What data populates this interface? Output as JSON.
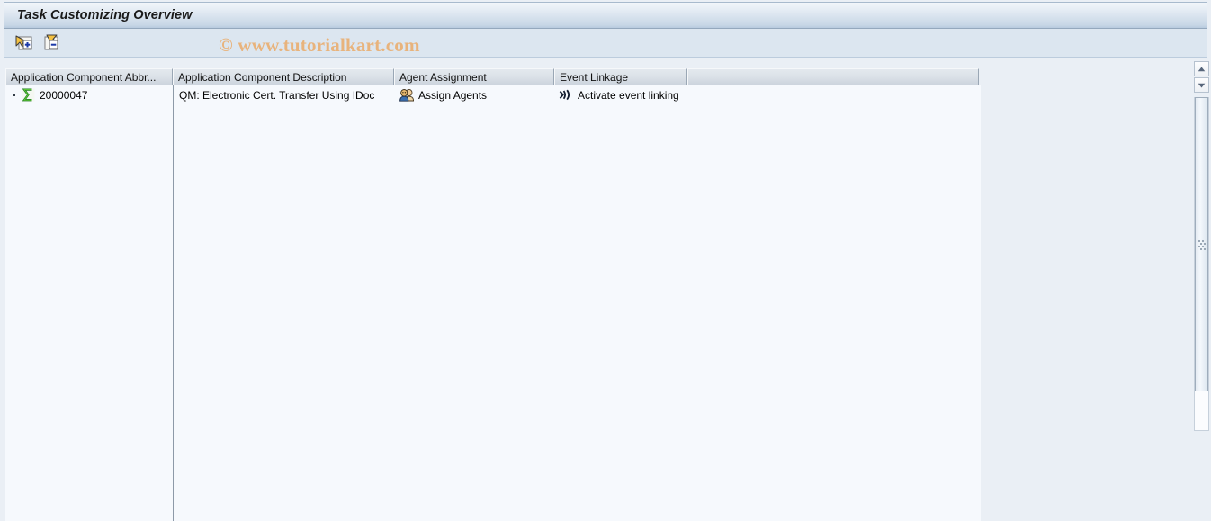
{
  "window": {
    "title": "Task Customizing Overview"
  },
  "toolbar": {
    "buttons": [
      {
        "name": "expand-all-button",
        "icon": "expand-all-icon",
        "tooltip": "Expand all"
      },
      {
        "name": "collapse-all-button",
        "icon": "collapse-all-icon",
        "tooltip": "Collapse all"
      }
    ]
  },
  "watermark": {
    "text": "© www.tutorialkart.com",
    "color": "#e8b37c"
  },
  "grid": {
    "columns": [
      {
        "label": "Application Component Abbr..."
      },
      {
        "label": "Application Component Description"
      },
      {
        "label": "Agent Assignment"
      },
      {
        "label": "Event Linkage"
      },
      {
        "label": ""
      }
    ],
    "rows": [
      {
        "node_icon": "sigma-task-icon",
        "component_abbr": "20000047",
        "component_description": "QM: Electronic Cert. Transfer Using IDoc",
        "agent_assignment_icon": "two-persons-icon",
        "agent_assignment": "Assign Agents",
        "event_linkage_icon": "broadcast-signal-icon",
        "event_linkage": "Activate event linking"
      }
    ]
  },
  "scrollbar": {
    "up_icon": "scroll-up-arrow-icon",
    "down_icon": "scroll-down-arrow-icon",
    "grip_icon": "scroll-grip-icon"
  },
  "colors": {
    "title_bar_accent": "#b8cade",
    "toolbar_bg": "#dce6f0",
    "table_bg": "#f6f9fd",
    "window_bg": "#eaeff5",
    "header_bg": "#dbe1e8"
  }
}
